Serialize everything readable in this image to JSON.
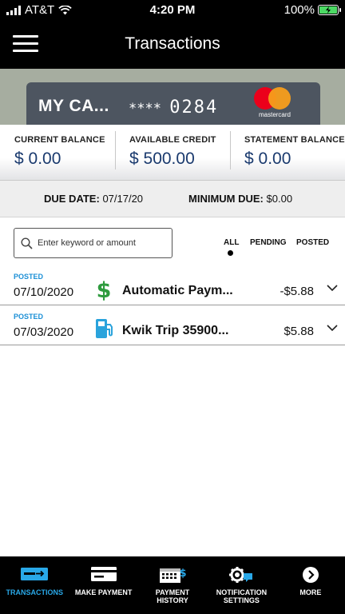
{
  "status_bar": {
    "carrier": "AT&T",
    "time": "4:20 PM",
    "battery": "100%"
  },
  "header": {
    "title": "Transactions",
    "menu_icon": "hamburger-menu-icon"
  },
  "card": {
    "name": "MY CA...",
    "number_mask": "****",
    "last_four": "0284",
    "brand_text": "mastercard"
  },
  "balances": [
    {
      "label": "CURRENT BALANCE",
      "value": "$ 0.00"
    },
    {
      "label": "AVAILABLE CREDIT",
      "value": "$ 500.00"
    },
    {
      "label": "STATEMENT BALANCE",
      "value": "$ 0.00"
    }
  ],
  "due": {
    "date_label": "DUE DATE:",
    "date_value": "07/17/20",
    "minimum_label": "MINIMUM DUE:",
    "minimum_value": "$0.00"
  },
  "search": {
    "placeholder": "Enter keyword or amount"
  },
  "filters": {
    "items": [
      "ALL",
      "PENDING",
      "POSTED"
    ],
    "selected": "ALL"
  },
  "transactions": [
    {
      "status": "POSTED",
      "date": "07/10/2020",
      "merchant": "Automatic Paym...",
      "amount": "-$5.88",
      "icon": "dollar-sign-icon"
    },
    {
      "status": "POSTED",
      "date": "07/03/2020",
      "merchant": "Kwik Trip 35900...",
      "amount": "$5.88",
      "icon": "gas-pump-icon"
    }
  ],
  "bottom_nav": [
    {
      "label": "TRANSACTIONS",
      "icon": "card-transfer-icon",
      "active": true
    },
    {
      "label": "MAKE PAYMENT",
      "icon": "card-icon",
      "active": false
    },
    {
      "label": "PAYMENT HISTORY",
      "icon": "calendar-dollar-icon",
      "active": false
    },
    {
      "label": "NOTIFICATION SETTINGS",
      "icon": "gear-chat-icon",
      "active": false
    },
    {
      "label": "MORE",
      "icon": "chevron-right-circle-icon",
      "active": false
    }
  ],
  "colors": {
    "accent_blue": "#1b8fd6",
    "balance_blue": "#1a3a6e",
    "nav_active": "#29a8e8",
    "money_green": "#2e9b3e"
  }
}
